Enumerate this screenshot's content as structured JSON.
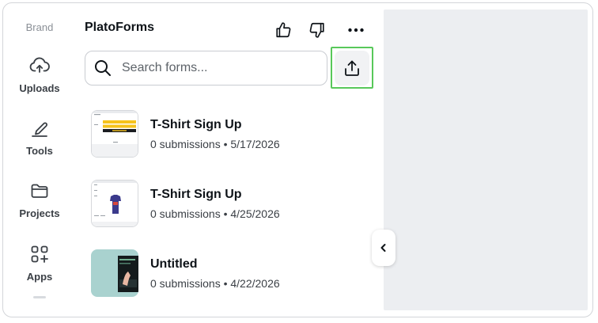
{
  "rail": {
    "brand": "Brand",
    "items": [
      {
        "label": "Uploads",
        "icon": "cloud-upload-icon"
      },
      {
        "label": "Tools",
        "icon": "pen-tool-icon"
      },
      {
        "label": "Projects",
        "icon": "folder-icon"
      },
      {
        "label": "Apps",
        "icon": "apps-grid-icon"
      }
    ]
  },
  "panel": {
    "title": "PlatoForms",
    "search_placeholder": "Search forms...",
    "forms": [
      {
        "name": "T-Shirt Sign Up",
        "meta": "0 submissions • 5/17/2026"
      },
      {
        "name": "T-Shirt Sign Up",
        "meta": "0 submissions • 4/25/2026"
      },
      {
        "name": "Untitled",
        "meta": "0 submissions • 4/22/2026"
      }
    ]
  },
  "colors": {
    "accent_border": "#58c85a",
    "thumb_yellow": "#f6c31c",
    "thumb_teal": "#a9d2cf",
    "shirt_purple": "#3b3a8c"
  }
}
